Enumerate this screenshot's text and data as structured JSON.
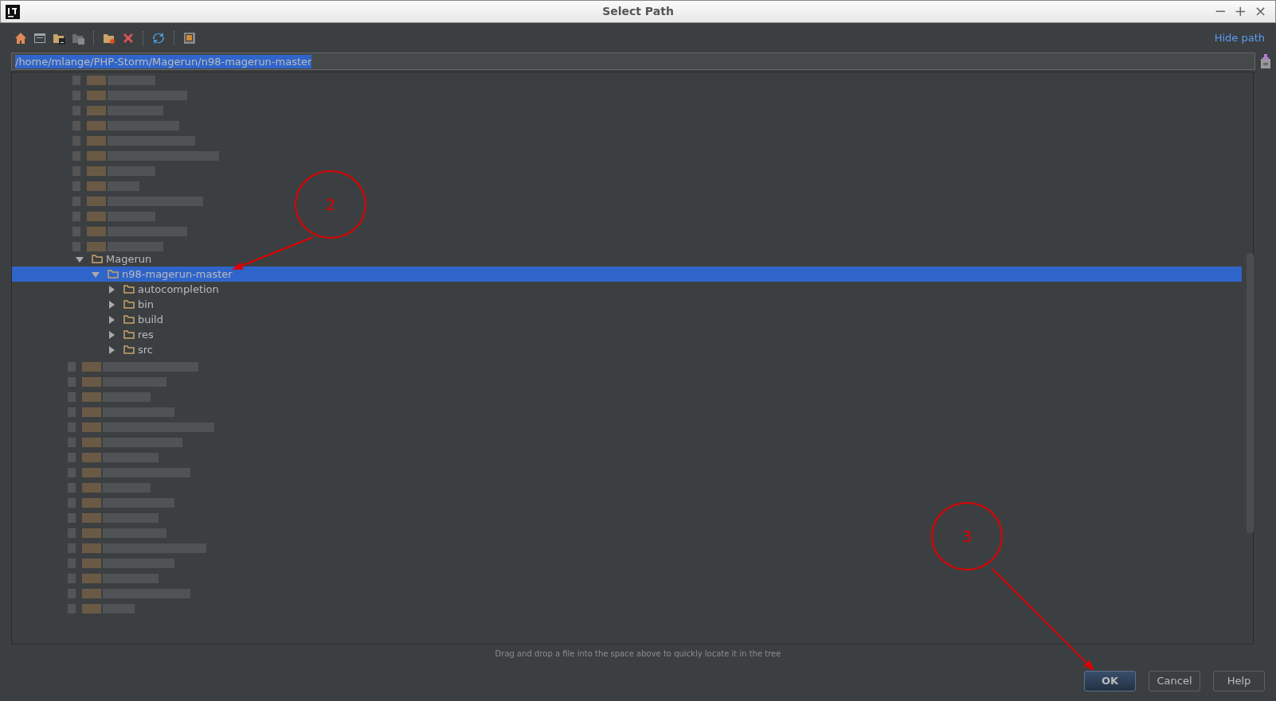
{
  "window": {
    "title": "Select Path",
    "controls": [
      "−",
      "+",
      "×"
    ]
  },
  "toolbar": {
    "hide_path": "Hide path"
  },
  "path": {
    "value": "/home/mlange/PHP-Storm/Magerun/n98-magerun-master"
  },
  "tree": [
    {
      "label": "Magerun",
      "expanded": true,
      "selected": false,
      "children": [
        {
          "label": "n98-magerun-master",
          "expanded": true,
          "selected": true,
          "children": [
            {
              "label": "autocompletion",
              "expanded": false,
              "selected": false
            },
            {
              "label": "bin",
              "expanded": false,
              "selected": false
            },
            {
              "label": "build",
              "expanded": false,
              "selected": false
            },
            {
              "label": "res",
              "expanded": false,
              "selected": false
            },
            {
              "label": "src",
              "expanded": false,
              "selected": false
            }
          ]
        }
      ]
    }
  ],
  "hint": "Drag and drop a file into the space above to quickly locate it in the tree",
  "buttons": [
    {
      "label": "OK",
      "default": true
    },
    {
      "label": "Cancel",
      "default": false
    },
    {
      "label": "Help",
      "default": false
    }
  ],
  "annotations": [
    {
      "label": "2"
    },
    {
      "label": "3"
    }
  ]
}
